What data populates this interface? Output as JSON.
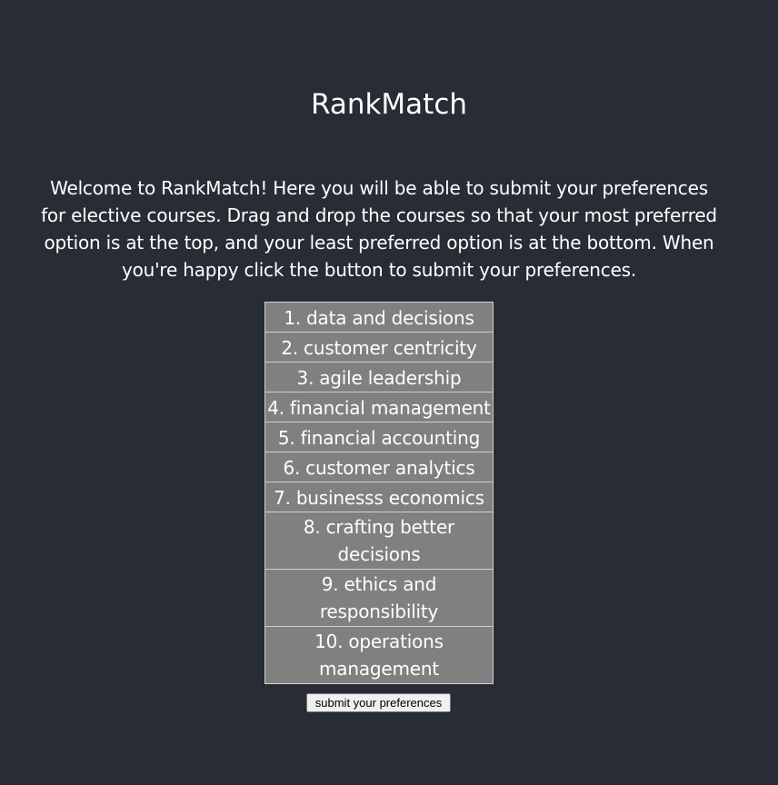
{
  "app": {
    "title": "RankMatch",
    "intro": "Welcome to RankMatch! Here you will be able to submit your preferences for elective courses. Drag and drop the courses so that your most preferred option is at the top, and your least preferred option is at the bottom. When you're happy click the button to submit your preferences."
  },
  "courses": [
    {
      "rank": "1.",
      "name": "data and decisions"
    },
    {
      "rank": "2.",
      "name": "customer centricity"
    },
    {
      "rank": "3.",
      "name": "agile leadership"
    },
    {
      "rank": "4.",
      "name": "financial management"
    },
    {
      "rank": "5.",
      "name": "financial accounting"
    },
    {
      "rank": "6.",
      "name": "customer analytics"
    },
    {
      "rank": "7.",
      "name": "businesss economics"
    },
    {
      "rank": "8.",
      "name": "crafting better decisions"
    },
    {
      "rank": "9.",
      "name": "ethics and responsibility"
    },
    {
      "rank": "10.",
      "name": "operations management"
    }
  ],
  "submit": {
    "label": "submit your preferences"
  },
  "colors": {
    "background": "#282c34",
    "item_background": "#808080",
    "item_border": "#d0d0d0"
  }
}
